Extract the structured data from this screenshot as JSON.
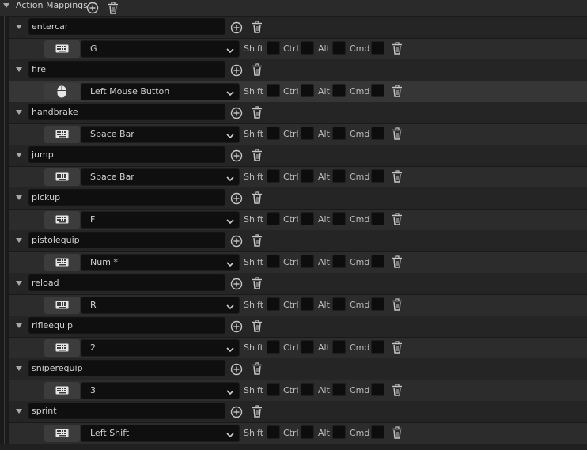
{
  "section": {
    "title": "Action Mappings"
  },
  "modifiers": {
    "shift": "Shift",
    "ctrl": "Ctrl",
    "alt": "Alt",
    "cmd": "Cmd"
  },
  "mappings": [
    {
      "name": "entercar",
      "device": "keyboard",
      "key": "G"
    },
    {
      "name": "fire",
      "device": "mouse",
      "key": "Left Mouse Button"
    },
    {
      "name": "handbrake",
      "device": "keyboard",
      "key": "Space Bar"
    },
    {
      "name": "jump",
      "device": "keyboard",
      "key": "Space Bar"
    },
    {
      "name": "pickup",
      "device": "keyboard",
      "key": "F"
    },
    {
      "name": "pistolequip",
      "device": "keyboard",
      "key": "Num *"
    },
    {
      "name": "reload",
      "device": "keyboard",
      "key": "R"
    },
    {
      "name": "rifleequip",
      "device": "keyboard",
      "key": "2"
    },
    {
      "name": "sniperequip",
      "device": "keyboard",
      "key": "3"
    },
    {
      "name": "sprint",
      "device": "keyboard",
      "key": "Left Shift"
    }
  ],
  "highlighted_index": 1,
  "icons": {
    "add": "add-icon",
    "delete": "trash-icon",
    "expand": "expand-arrow-icon",
    "keyboard": "keyboard-icon",
    "mouse": "mouse-icon",
    "dropdown": "chevron-down-icon"
  },
  "colors": {
    "background": "#1a1a1a",
    "action_row": "#252525",
    "key_row": "#2c2c2c",
    "input_bg": "#0f0f0f",
    "device_button": "#3c3c3c",
    "text": "#d0d0d0"
  }
}
